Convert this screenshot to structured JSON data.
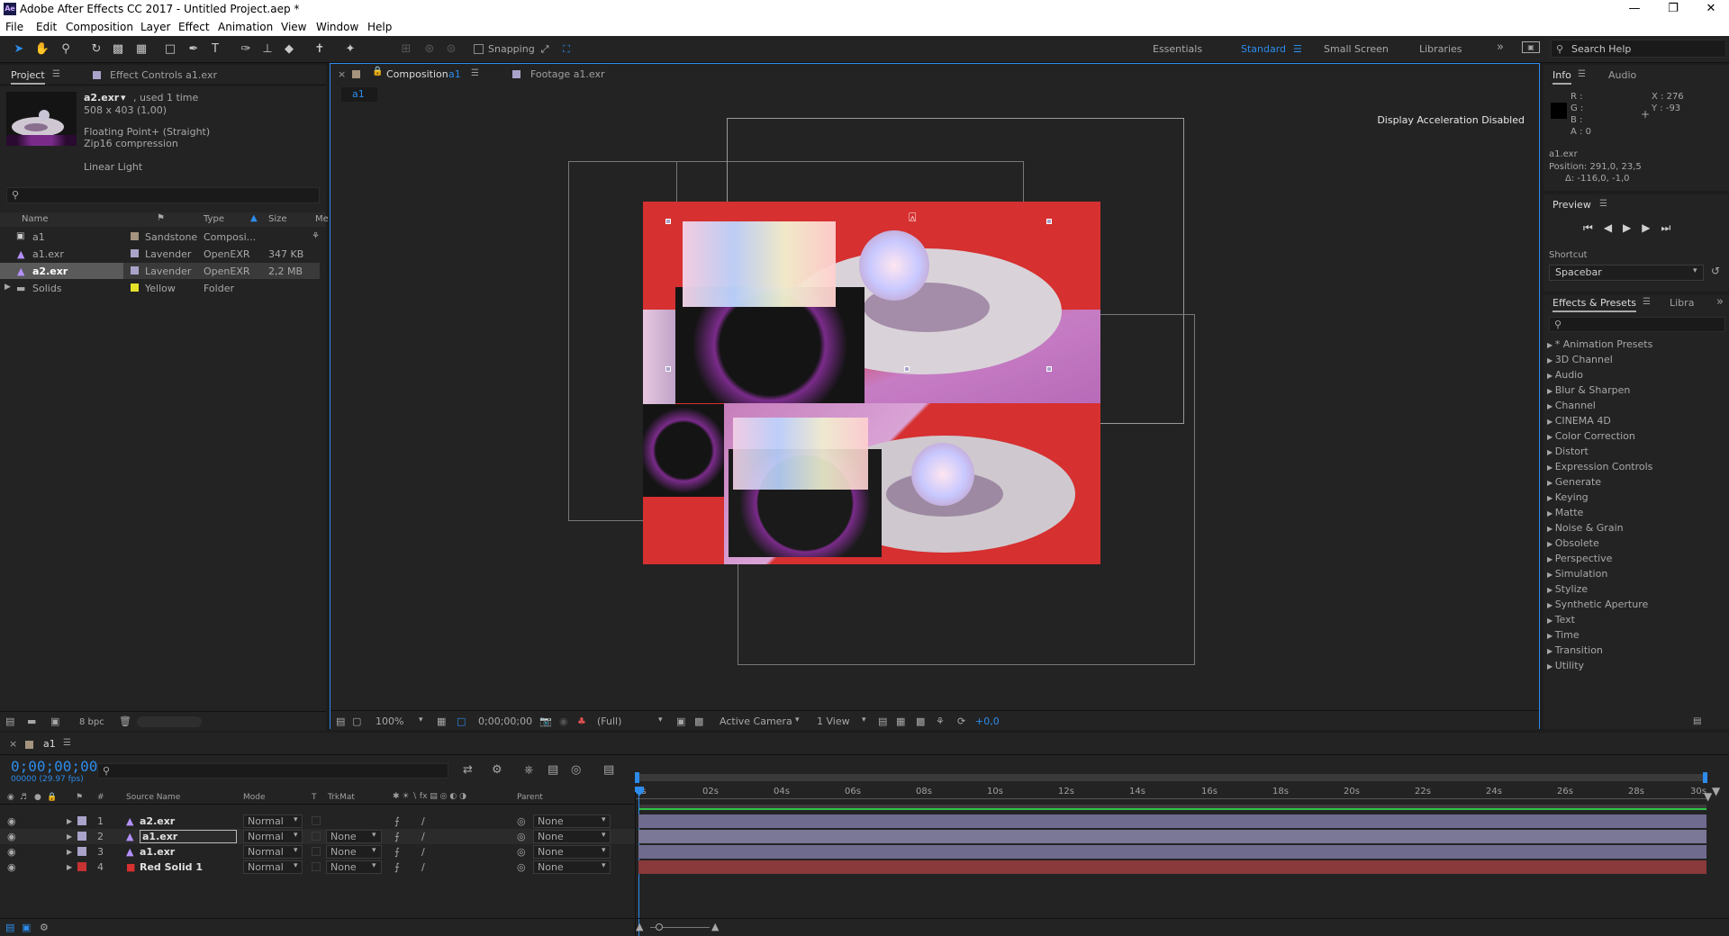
{
  "window": {
    "title": "Adobe After Effects CC 2017 - Untitled Project.aep *",
    "app_icon": "Ae"
  },
  "menu": [
    "File",
    "Edit",
    "Composition",
    "Layer",
    "Effect",
    "Animation",
    "View",
    "Window",
    "Help"
  ],
  "toolbar": {
    "snapping_label": "Snapping",
    "workspaces": [
      "Essentials",
      "Standard",
      "Small Screen",
      "Libraries"
    ],
    "active_workspace": "Standard",
    "search_placeholder": "Search Help"
  },
  "project_panel": {
    "tab_project": "Project",
    "tab_effect_controls": "Effect Controls a1.exr",
    "selected": {
      "name": "a2.exr",
      "usage": ", used 1 time",
      "dims": "508 x 403 (1,00)",
      "format": "Floating Point+ (Straight)",
      "compression": "Zip16 compression",
      "color": "Linear Light"
    },
    "columns": [
      "Name",
      "Type",
      "Size",
      "Me"
    ],
    "items": [
      {
        "name": "a1",
        "label": "Sandstone",
        "type": "Composi...",
        "size": "",
        "color": "#a4937d"
      },
      {
        "name": "a1.exr",
        "label": "Lavender",
        "type": "OpenEXR",
        "size": "347 KB",
        "color": "#a9a3c9"
      },
      {
        "name": "a2.exr",
        "label": "Lavender",
        "type": "OpenEXR",
        "size": "2,2 MB",
        "color": "#a9a3c9"
      },
      {
        "name": "Solids",
        "label": "Yellow",
        "type": "Folder",
        "size": "",
        "color": "#e5e12a"
      }
    ],
    "bpc": "8 bpc"
  },
  "comp_panel": {
    "tab_comp": "Composition",
    "tab_comp_name": "a1",
    "tab_footage": "Footage a1.exr",
    "breadcrumb": "a1",
    "notice": "Display Acceleration Disabled",
    "bottom": {
      "zoom": "100%",
      "timecode": "0;00;00;00",
      "resolution": "(Full)",
      "camera": "Active Camera",
      "views": "1 View",
      "exposure": "+0,0"
    }
  },
  "info_panel": {
    "tab_info": "Info",
    "tab_audio": "Audio",
    "r": "R :",
    "g": "G :",
    "b": "B :",
    "a": "A : 0",
    "x": "X : 276",
    "y": "Y : -93",
    "layer": "a1.exr",
    "position": "Position: 291,0, 23,5",
    "delta": "Δ: -116,0, -1,0"
  },
  "preview_panel": {
    "title": "Preview",
    "shortcut_label": "Shortcut",
    "shortcut_value": "Spacebar"
  },
  "effects_panel": {
    "tab": "Effects & Presets",
    "tab2": "Libra",
    "items": [
      "* Animation Presets",
      "3D Channel",
      "Audio",
      "Blur & Sharpen",
      "Channel",
      "CINEMA 4D",
      "Color Correction",
      "Distort",
      "Expression Controls",
      "Generate",
      "Keying",
      "Matte",
      "Noise & Grain",
      "Obsolete",
      "Perspective",
      "Simulation",
      "Stylize",
      "Synthetic Aperture",
      "Text",
      "Time",
      "Transition",
      "Utility"
    ]
  },
  "timeline": {
    "tab": "a1",
    "timecode": "0;00;00;00",
    "fps": "00000 (29.97 fps)",
    "columns": {
      "num": "#",
      "source": "Source Name",
      "mode": "Mode",
      "t": "T",
      "trkmat": "TrkMat",
      "parent": "Parent"
    },
    "layers": [
      {
        "num": "1",
        "name": "a2.exr",
        "mode": "Normal",
        "trkmat": "",
        "parent": "None",
        "color": "#a9a3c9",
        "bar": "#6f6b8f"
      },
      {
        "num": "2",
        "name": "a1.exr",
        "mode": "Normal",
        "trkmat": "None",
        "parent": "None",
        "color": "#a9a3c9",
        "bar": "#7b7796"
      },
      {
        "num": "3",
        "name": "a1.exr",
        "mode": "Normal",
        "trkmat": "None",
        "parent": "None",
        "color": "#a9a3c9",
        "bar": "#6f6b8f"
      },
      {
        "num": "4",
        "name": "Red Solid 1",
        "mode": "Normal",
        "trkmat": "None",
        "parent": "None",
        "color": "#c83232",
        "bar": "#8a3a3a"
      }
    ],
    "ruler": [
      "0s",
      "02s",
      "04s",
      "06s",
      "08s",
      "10s",
      "12s",
      "14s",
      "16s",
      "18s",
      "20s",
      "22s",
      "24s",
      "26s",
      "28s",
      "30s"
    ]
  },
  "colors": {
    "accent": "#2d8ceb",
    "panel": "#232323",
    "background": "#1d1d1d",
    "red_solid": "#d63030"
  }
}
